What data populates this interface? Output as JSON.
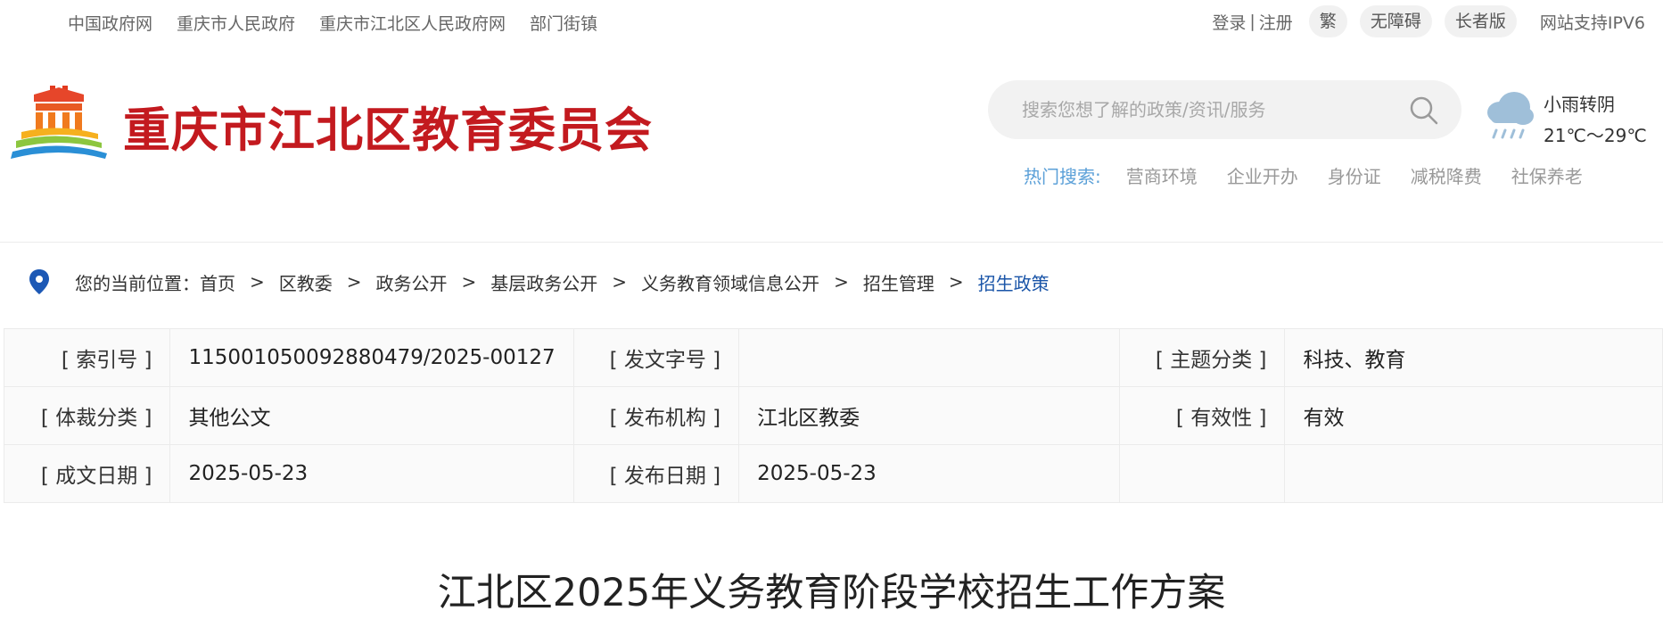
{
  "top_links": [
    "中国政府网",
    "重庆市人民政府",
    "重庆市江北区人民政府网",
    "部门街镇"
  ],
  "account": {
    "login": "登录",
    "separator": "|",
    "register": "注册"
  },
  "toggles": {
    "traditional": "繁",
    "accessible": "无障碍",
    "elder": "长者版"
  },
  "ipv6": "网站支持IPV6",
  "site_title": "重庆市江北区教育委员会",
  "search": {
    "placeholder": "搜索您想了解的政策/资讯/服务"
  },
  "hot_search": {
    "label": "热门搜索:",
    "items": [
      "营商环境",
      "企业开办",
      "身份证",
      "减税降费",
      "社保养老"
    ]
  },
  "weather": {
    "desc": "小雨转阴",
    "temp": "21℃～29℃"
  },
  "breadcrumb": {
    "prefix": "您的当前位置：",
    "items": [
      "首页",
      "区教委",
      "政务公开",
      "基层政务公开",
      "义务教育领域信息公开",
      "招生管理"
    ],
    "current": "招生政策",
    "separator": ">"
  },
  "info_table": {
    "rows": [
      [
        {
          "k": "[ 索引号 ]",
          "v": "115001050092880479/2025-00127"
        },
        {
          "k": "[ 发文字号 ]",
          "v": ""
        },
        {
          "k": "[ 主题分类 ]",
          "v": "科技、教育"
        }
      ],
      [
        {
          "k": "[ 体裁分类 ]",
          "v": "其他公文"
        },
        {
          "k": "[ 发布机构 ]",
          "v": "江北区教委"
        },
        {
          "k": "[ 有效性 ]",
          "v": "有效"
        }
      ],
      [
        {
          "k": "[ 成文日期 ]",
          "v": "2025-05-23"
        },
        {
          "k": "[ 发布日期 ]",
          "v": "2025-05-23"
        },
        {
          "k": "",
          "v": ""
        }
      ]
    ]
  },
  "article_title": "江北区2025年义务教育阶段学校招生工作方案",
  "colors": {
    "brand_red": "#c31a1f",
    "link_blue": "#1a55a8",
    "hot_blue": "#5ba0d8"
  }
}
